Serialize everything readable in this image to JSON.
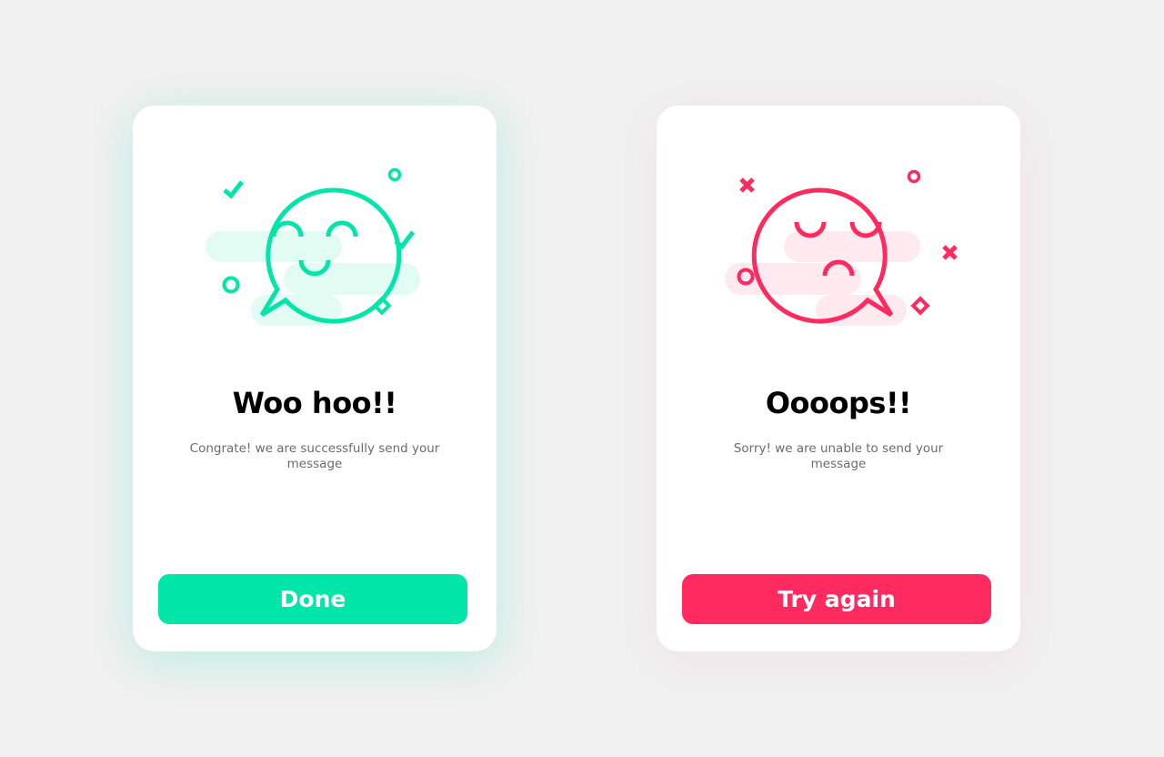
{
  "colors": {
    "background": "#f0f0f0",
    "card": "#ffffff",
    "success": "#00e6a9",
    "success_tint": "#e2fbf3",
    "error": "#ff2a5f",
    "error_tint": "#ffeaef",
    "title": "#000000",
    "message": "#6b6b6b"
  },
  "success_card": {
    "illustration": "happy-speech-bubble-icon",
    "title": "Woo hoo!!",
    "message": "Congrate! we are successfully send your message",
    "button_label": "Done"
  },
  "error_card": {
    "illustration": "sad-speech-bubble-icon",
    "title": "Oooops!!",
    "message": "Sorry! we are unable to send your message",
    "button_label": "Try again"
  }
}
